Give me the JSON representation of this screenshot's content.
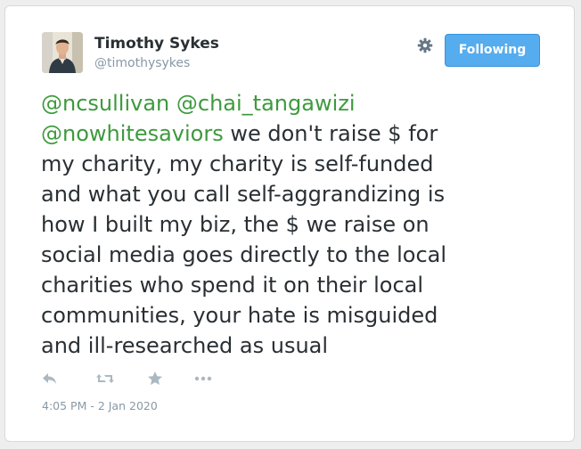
{
  "user": {
    "name": "Timothy Sykes",
    "handle": "@timothysykes"
  },
  "follow_button": {
    "label": "Following"
  },
  "tweet": {
    "mentions": [
      "@ncsullivan",
      "@chai_tangawizi",
      "@nowhitesaviors"
    ],
    "line1_tail": "we don't raise $ for",
    "lines": [
      "my charity, my charity is self-funded",
      "and what you call self-aggrandizing is",
      "how I built my biz, the $ we raise on",
      "social media goes directly to the local",
      "charities who spend it on their local",
      "communities, your hate is misguided",
      "and ill-researched as usual"
    ],
    "timestamp": "4:05 PM - 2 Jan 2020"
  },
  "icons": {
    "settings": "gear-icon",
    "reply": "reply-icon",
    "retweet": "retweet-icon",
    "favorite": "star-icon",
    "more": "more-icon"
  },
  "colors": {
    "mention": "#3d9a3d",
    "button_bg": "#55acee",
    "muted": "#8899a6",
    "text": "#292f33",
    "icon": "#aab8c2"
  }
}
